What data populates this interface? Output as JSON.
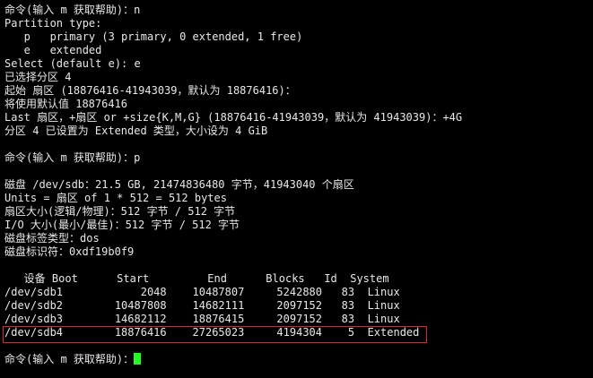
{
  "terminal": {
    "lines": [
      "命令(输入 m 获取帮助)：n",
      "Partition type:",
      "   p   primary (3 primary, 0 extended, 1 free)",
      "   e   extended",
      "Select (default e): e",
      "已选择分区 4",
      "起始 扇区 (18876416-41943039，默认为 18876416)：",
      "将使用默认值 18876416",
      "Last 扇区，+扇区 or +size{K,M,G} (18876416-41943039，默认为 41943039)：+4G",
      "分区 4 已设置为 Extended 类型，大小设为 4 GiB",
      "",
      "命令(输入 m 获取帮助)：p",
      "",
      "磁盘 /dev/sdb：21.5 GB, 21474836480 字节，41943040 个扇区",
      "Units = 扇区 of 1 * 512 = 512 bytes",
      "扇区大小(逻辑/物理)：512 字节 / 512 字节",
      "I/O 大小(最小/最佳)：512 字节 / 512 字节",
      "磁盘标签类型：dos",
      "磁盘标识符：0xdf19b0f9",
      "",
      "   设备 Boot      Start         End      Blocks   Id  System",
      "/dev/sdb1            2048    10487807     5242880   83  Linux",
      "/dev/sdb2        10487808    14682111     2097152   83  Linux",
      "/dev/sdb3        14682112    18876415     2097152   83  Linux",
      "/dev/sdb4        18876416    27265023     4194304    5  Extended",
      "",
      "命令(输入 m 获取帮助)："
    ]
  },
  "colors": {
    "background": "#000000",
    "text": "#e8e8e8",
    "cursor": "#22ff22",
    "highlight_border": "#d8262c"
  }
}
